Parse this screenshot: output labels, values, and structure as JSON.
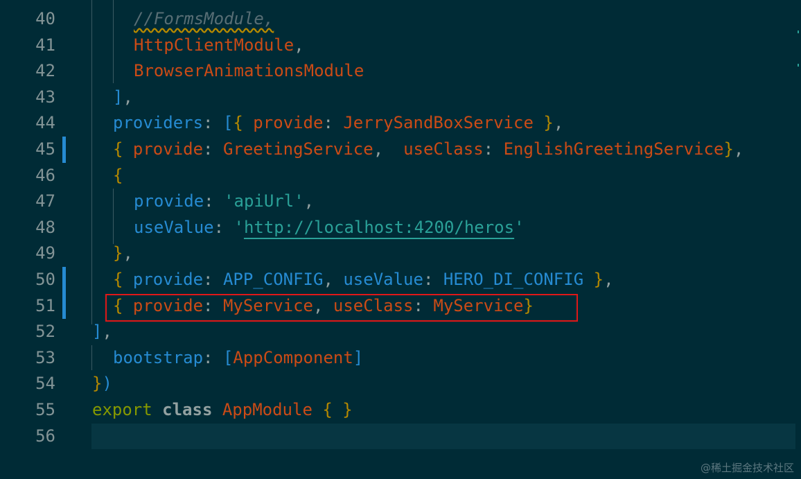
{
  "editor": {
    "lines": [
      {
        "num": "40",
        "tokens": [
          {
            "t": "//FormsModule,",
            "c": "t-cmt squiggle"
          }
        ]
      },
      {
        "num": "41",
        "tokens": [
          {
            "t": "HttpClientModule",
            "c": "t-id"
          },
          {
            "t": ",",
            "c": "t-punc"
          }
        ]
      },
      {
        "num": "42",
        "tokens": [
          {
            "t": "BrowserAnimationsModule",
            "c": "t-id"
          }
        ]
      },
      {
        "num": "43",
        "tokens": [
          {
            "t": "]",
            "c": "t-brk2"
          },
          {
            "t": ",",
            "c": "t-punc"
          }
        ]
      },
      {
        "num": "44",
        "tokens": [
          {
            "t": "providers",
            "c": "t-prop"
          },
          {
            "t": ": ",
            "c": "t-punc"
          },
          {
            "t": "[",
            "c": "t-brk2"
          },
          {
            "t": "{",
            "c": "t-brk"
          },
          {
            "t": " provide",
            "c": "t-id"
          },
          {
            "t": ": ",
            "c": "t-punc"
          },
          {
            "t": "JerrySandBoxService",
            "c": "t-id"
          },
          {
            "t": " }",
            "c": "t-brk"
          },
          {
            "t": ",",
            "c": "t-punc"
          }
        ]
      },
      {
        "num": "45",
        "tokens": [
          {
            "t": "{",
            "c": "t-brk"
          },
          {
            "t": " provide",
            "c": "t-id"
          },
          {
            "t": ": ",
            "c": "t-punc"
          },
          {
            "t": "GreetingService",
            "c": "t-id"
          },
          {
            "t": ",  ",
            "c": "t-punc"
          },
          {
            "t": "useClass",
            "c": "t-id"
          },
          {
            "t": ": ",
            "c": "t-punc"
          },
          {
            "t": "EnglishGreetingService",
            "c": "t-id"
          },
          {
            "t": "}",
            "c": "t-brk"
          },
          {
            "t": ",",
            "c": "t-punc"
          }
        ]
      },
      {
        "num": "46",
        "tokens": [
          {
            "t": "{",
            "c": "t-brk"
          }
        ]
      },
      {
        "num": "47",
        "tokens": [
          {
            "t": "provide",
            "c": "t-prop"
          },
          {
            "t": ": ",
            "c": "t-punc"
          },
          {
            "t": "'apiUrl'",
            "c": "t-str"
          },
          {
            "t": ",",
            "c": "t-punc"
          }
        ]
      },
      {
        "num": "48",
        "tokens": [
          {
            "t": "useValue",
            "c": "t-prop"
          },
          {
            "t": ": ",
            "c": "t-punc"
          },
          {
            "t": "'",
            "c": "t-str"
          },
          {
            "t": "http://localhost:4200/heros",
            "c": "t-str link"
          },
          {
            "t": "'",
            "c": "t-str"
          }
        ]
      },
      {
        "num": "49",
        "tokens": [
          {
            "t": "}",
            "c": "t-brk"
          },
          {
            "t": ",",
            "c": "t-punc"
          }
        ]
      },
      {
        "num": "50",
        "tokens": [
          {
            "t": "{",
            "c": "t-brk"
          },
          {
            "t": " provide",
            "c": "t-prop"
          },
          {
            "t": ": ",
            "c": "t-punc"
          },
          {
            "t": "APP_CONFIG",
            "c": "t-prop"
          },
          {
            "t": ", ",
            "c": "t-punc"
          },
          {
            "t": "useValue",
            "c": "t-prop"
          },
          {
            "t": ": ",
            "c": "t-punc"
          },
          {
            "t": "HERO_DI_CONFIG",
            "c": "t-prop"
          },
          {
            "t": " }",
            "c": "t-brk"
          },
          {
            "t": ",",
            "c": "t-punc"
          }
        ]
      },
      {
        "num": "51",
        "tokens": [
          {
            "t": "{",
            "c": "t-brk"
          },
          {
            "t": " provide",
            "c": "t-id"
          },
          {
            "t": ": ",
            "c": "t-punc"
          },
          {
            "t": "MyService",
            "c": "t-id"
          },
          {
            "t": ", ",
            "c": "t-punc"
          },
          {
            "t": "useClass",
            "c": "t-id"
          },
          {
            "t": ": ",
            "c": "t-punc"
          },
          {
            "t": "MyService",
            "c": "t-id"
          },
          {
            "t": "}",
            "c": "t-brk"
          }
        ]
      },
      {
        "num": "52",
        "tokens": [
          {
            "t": "]",
            "c": "t-brk2"
          },
          {
            "t": ",",
            "c": "t-punc"
          }
        ]
      },
      {
        "num": "53",
        "tokens": [
          {
            "t": "bootstrap",
            "c": "t-prop"
          },
          {
            "t": ": ",
            "c": "t-punc"
          },
          {
            "t": "[",
            "c": "t-brk2"
          },
          {
            "t": "AppComponent",
            "c": "t-id"
          },
          {
            "t": "]",
            "c": "t-brk2"
          }
        ]
      },
      {
        "num": "54",
        "tokens": [
          {
            "t": "}",
            "c": "t-brk"
          },
          {
            "t": ")",
            "c": "t-brk2"
          }
        ]
      },
      {
        "num": "55",
        "tokens": [
          {
            "t": "export",
            "c": "t-kw"
          },
          {
            "t": " ",
            "c": "t-plain"
          },
          {
            "t": "class",
            "c": "t-kw2"
          },
          {
            "t": " ",
            "c": "t-plain"
          },
          {
            "t": "AppModule",
            "c": "t-id"
          },
          {
            "t": " { }",
            "c": "t-brk"
          }
        ]
      },
      {
        "num": "56",
        "tokens": []
      }
    ],
    "modified_lines": [
      "45",
      "50",
      "51"
    ],
    "current_line": "56",
    "highlighted_line": "51"
  },
  "watermark": "@稀土掘金技术社区",
  "colors": {
    "background": "#002b36",
    "line_number": "#839496",
    "identifier": "#cb4b16",
    "property": "#268bd2",
    "string": "#2aa198",
    "keyword": "#859900",
    "highlight_border": "#e01818"
  }
}
